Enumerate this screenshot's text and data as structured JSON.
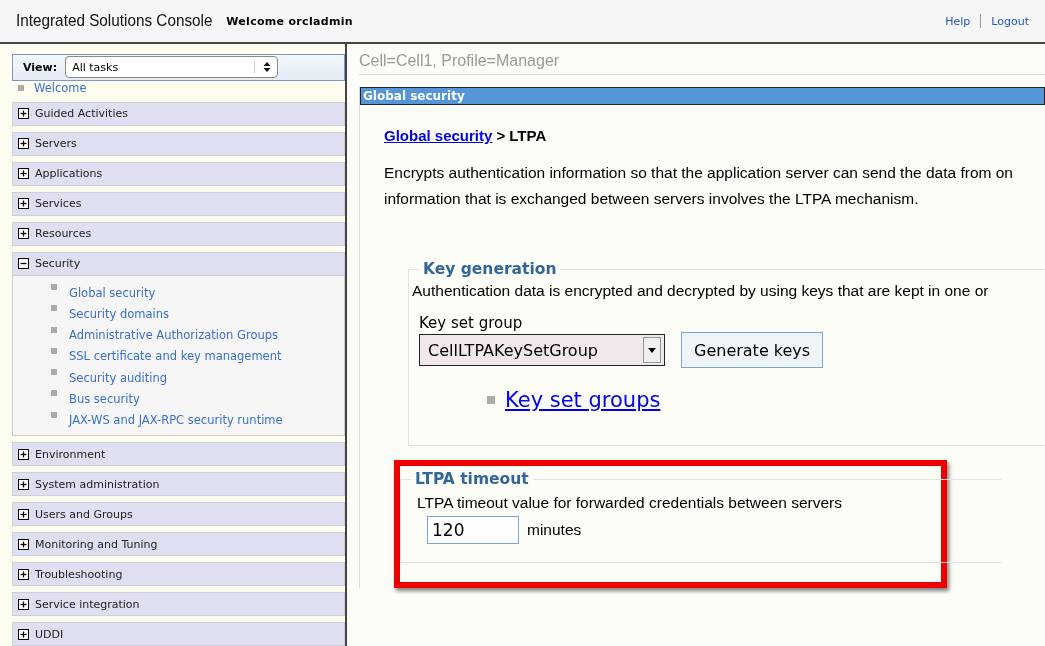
{
  "header": {
    "title": "Integrated Solutions Console",
    "welcome": "Welcome orcladmin",
    "links": [
      "Help",
      "Logout"
    ]
  },
  "sidebar": {
    "view_label": "View:",
    "view_value": "All tasks",
    "welcome_link": "Welcome",
    "items": [
      {
        "label": "Guided Activities",
        "expanded": false
      },
      {
        "label": "Servers",
        "expanded": false
      },
      {
        "label": "Applications",
        "expanded": false
      },
      {
        "label": "Services",
        "expanded": false
      },
      {
        "label": "Resources",
        "expanded": false
      },
      {
        "label": "Security",
        "expanded": true,
        "children": [
          "Global security",
          "Security domains",
          "Administrative Authorization Groups",
          "SSL certificate and key management",
          "Security auditing",
          "Bus security",
          "JAX-WS and JAX-RPC security runtime"
        ]
      },
      {
        "label": "Environment",
        "expanded": false
      },
      {
        "label": "System administration",
        "expanded": false
      },
      {
        "label": "Users and Groups",
        "expanded": false
      },
      {
        "label": "Monitoring and Tuning",
        "expanded": false
      },
      {
        "label": "Troubleshooting",
        "expanded": false
      },
      {
        "label": "Service integration",
        "expanded": false
      },
      {
        "label": "UDDI",
        "expanded": false
      }
    ]
  },
  "main": {
    "scope": "Cell=Cell1, Profile=Manager",
    "panel_title": "Global security",
    "breadcrumb_link": "Global security",
    "breadcrumb_current": "> LTPA",
    "description": [
      "Encrypts authentication information so that the application server can send the data from on",
      "information that is exchanged between servers involves the LTPA mechanism."
    ],
    "key_generation": {
      "legend": "Key generation",
      "text": "Authentication data is encrypted and decrypted by using keys that are kept in one or",
      "select_label": "Key set group",
      "select_value": "CellLTPAKeySetGroup",
      "button": "Generate keys",
      "link": "Key set groups"
    },
    "ltpa_timeout": {
      "legend": "LTPA timeout",
      "highlighted": true,
      "field_label": "LTPA timeout value for forwarded credentials between servers",
      "value": "120",
      "unit": "minutes"
    }
  }
}
